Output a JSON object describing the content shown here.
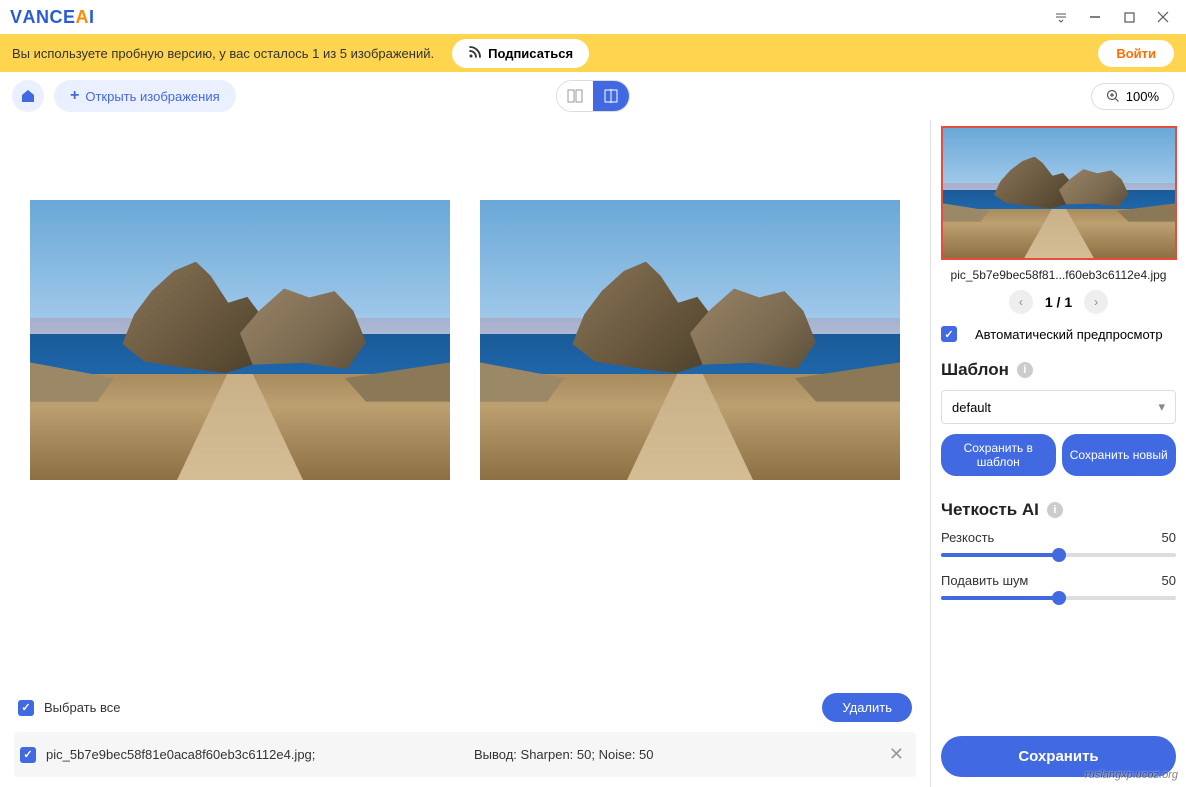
{
  "logo": {
    "part1": "V",
    "part2": "ANCE",
    "part3": "A",
    "part4": "I"
  },
  "banner": {
    "trial_text": "Вы используете пробную версию, у вас осталось 1 из 5 изображений.",
    "subscribe": "Подписаться",
    "login": "Войти"
  },
  "toolbar": {
    "open_images": "Открыть изображения",
    "zoom": "100%"
  },
  "filelist": {
    "select_all": "Выбрать все",
    "delete": "Удалить",
    "files": [
      {
        "name": "pic_5b7e9bec58f81e0aca8f60eb3c6112e4.jpg;",
        "output": "Вывод: Sharpen: 50; Noise: 50"
      }
    ]
  },
  "sidebar": {
    "thumb_name": "pic_5b7e9bec58f81...f60eb3c6112e4.jpg",
    "page_current": "1",
    "page_sep": " / ",
    "page_total": "1",
    "auto_preview": "Автоматический предпросмотр",
    "template_title": "Шаблон",
    "template_value": "default",
    "save_template": "Сохранить в шаблон",
    "save_new": "Сохранить новый",
    "sharpness_title": "Четкость AI",
    "sliders": {
      "sharpness": {
        "label": "Резкость",
        "value": "50",
        "pct": 50
      },
      "noise": {
        "label": "Подавить шум",
        "value": "50",
        "pct": 50
      }
    },
    "save": "Сохранить"
  },
  "watermark": "ruslangxp.ucoz.org"
}
